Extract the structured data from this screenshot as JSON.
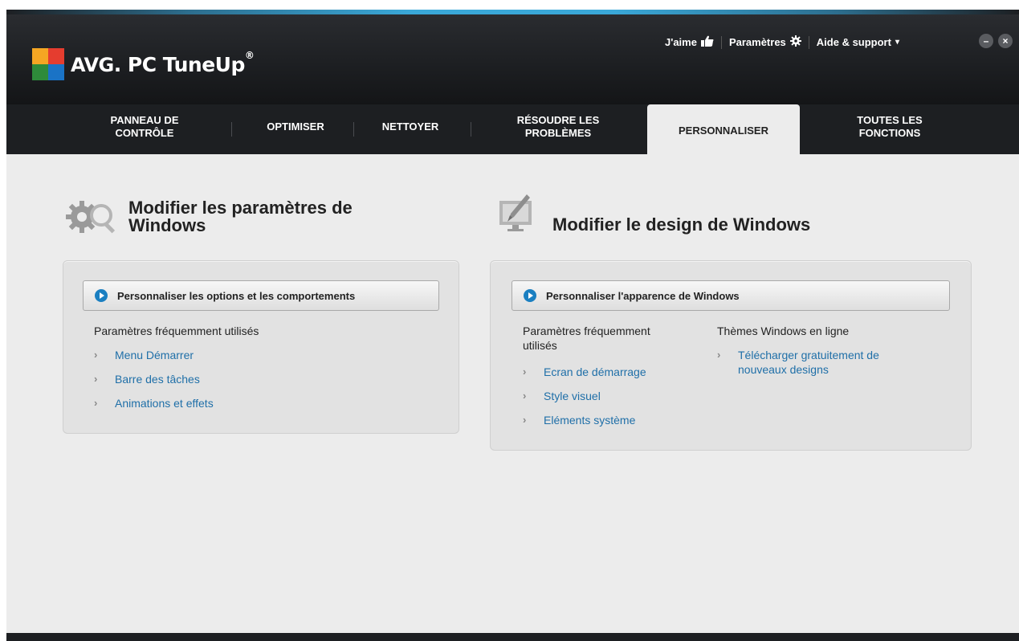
{
  "app": {
    "logo_brand": "AVG",
    "logo_product": "PC TuneUp",
    "logo_reg": "®"
  },
  "toplinks": {
    "like": "J'aime",
    "settings": "Paramètres",
    "help": "Aide & support",
    "help_caret": "▾"
  },
  "window_buttons": {
    "minimize": "–",
    "close": "×"
  },
  "tabs": [
    {
      "label_line1": "PANNEAU DE",
      "label_line2": "CONTRÔLE"
    },
    {
      "label": "OPTIMISER"
    },
    {
      "label": "NETTOYER"
    },
    {
      "label_line1": "RÉSOUDRE LES",
      "label_line2": "PROBLÈMES"
    },
    {
      "label": "PERSONNALISER",
      "active": true
    },
    {
      "label_line1": "TOUTES LES",
      "label_line2": "FONCTIONS"
    }
  ],
  "left_section": {
    "title_line1": "Modifier les paramètres de",
    "title_line2": "Windows",
    "icon": "gear-search-icon",
    "button": "Personnaliser les options et les comportements",
    "group_label": "Paramètres fréquemment utilisés",
    "links": [
      "Menu Démarrer",
      "Barre des tâches",
      "Animations et effets"
    ]
  },
  "right_section": {
    "title": "Modifier le design de Windows",
    "icon": "monitor-brush-icon",
    "button": "Personnaliser l'apparence de Windows",
    "group_label_line1": "Paramètres fréquemment",
    "group_label_line2": "utilisés",
    "links": [
      "Ecran de démarrage",
      "Style visuel",
      "Eléments système"
    ],
    "online_label": "Thèmes Windows en ligne",
    "online_link_line1": "Télécharger gratuitement de",
    "online_link_line2": "nouveaux designs"
  },
  "colors": {
    "header_bg": "#1d1f22",
    "content_bg": "#ececec",
    "link": "#1f6fa8",
    "accent": "#3aa8d8",
    "play_button": "#1a7fc1"
  }
}
